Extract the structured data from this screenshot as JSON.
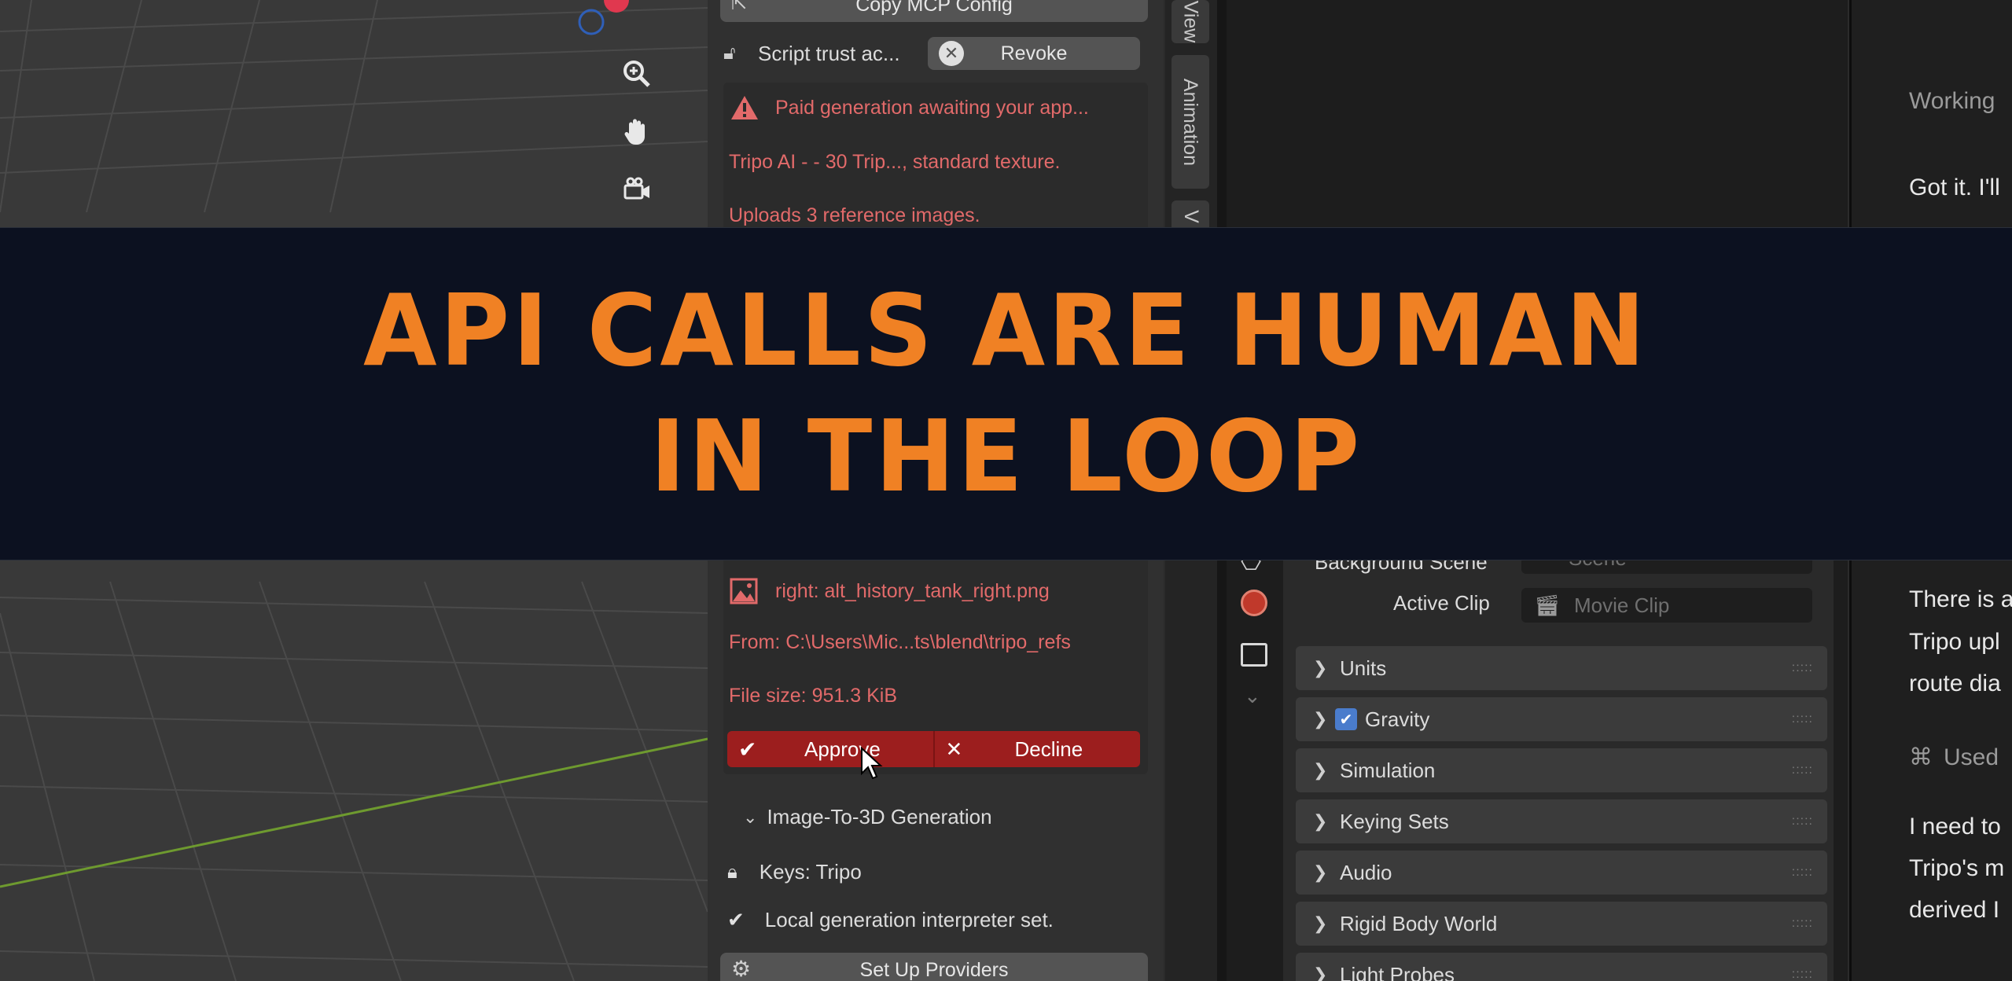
{
  "banner": {
    "line1": "API CALLS ARE HUMAN",
    "line2": "IN THE LOOP"
  },
  "npanel": {
    "copy_mcp_label": "Copy MCP Config",
    "script_trust_label": "Script trust ac...",
    "revoke_label": "Revoke",
    "warning_text": "Paid generation awaiting your app...",
    "detail_line": "Tripo AI - - 30 Trip..., standard texture.",
    "uploads_line": "Uploads 3 reference images.",
    "file_right": "right: alt_history_tank_right.png",
    "from_line": "From: C:\\Users\\Mic...ts\\blend\\tripo_refs",
    "file_size": "File size: 951.3 KiB",
    "approve_label": "Approve",
    "decline_label": "Decline",
    "section_title": "Image-To-3D Generation",
    "keys_label": "Keys: Tripo",
    "local_label": "Local generation interpreter set.",
    "setup_label": "Set Up Providers"
  },
  "tabs": {
    "view": "View",
    "animation": "Animation",
    "v": "V"
  },
  "properties": {
    "background_scene_label": "Background Scene",
    "background_scene_value": "Scene",
    "active_clip_label": "Active Clip",
    "active_clip_value": "Movie Clip",
    "panels": [
      "Units",
      "Gravity",
      "Simulation",
      "Keying Sets",
      "Audio",
      "Rigid Body World",
      "Light Probes"
    ],
    "gravity_checked": true
  },
  "chat": {
    "working": "Working",
    "got_it": "Got it. I'll",
    "there_is": "There is a",
    "tripo_upl": "Tripo upl",
    "route_dia": "route dia",
    "used": "Used",
    "i_need": "I need to",
    "tripos_m": "Tripo's m",
    "derived": "derived I"
  },
  "colors": {
    "accent": "#f08124",
    "banner_bg": "#0c1120",
    "approve_bg": "#9c1e1e",
    "warning_text": "#e26a6a"
  }
}
